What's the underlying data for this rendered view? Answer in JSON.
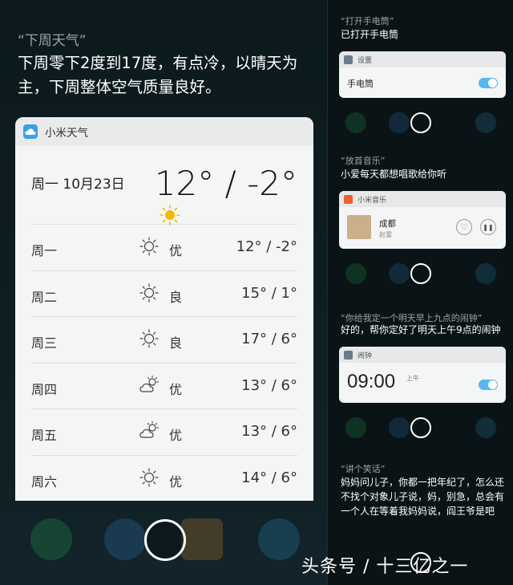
{
  "left": {
    "query": "“下周天气”",
    "answer": "下周零下2度到17度，有点冷，以晴天为主，下周整体空气质量良好。",
    "card": {
      "app_name": "小米天气",
      "today_date": "周一 10月23日",
      "today_temp": "12° / -2°",
      "rows": [
        {
          "day": "周一",
          "icon": "sunny-icon",
          "aq": "优",
          "temp": "12° / -2°"
        },
        {
          "day": "周二",
          "icon": "sunny-icon",
          "aq": "良",
          "temp": "15° / 1°"
        },
        {
          "day": "周三",
          "icon": "sunny-icon",
          "aq": "良",
          "temp": "17° / 6°"
        },
        {
          "day": "周四",
          "icon": "partly-cloudy-icon",
          "aq": "优",
          "temp": "13° / 6°"
        },
        {
          "day": "周五",
          "icon": "partly-cloudy-icon",
          "aq": "优",
          "temp": "13° / 6°"
        },
        {
          "day": "周六",
          "icon": "sunny-icon",
          "aq": "优",
          "temp": "14° / 6°"
        }
      ]
    }
  },
  "right": {
    "flashlight": {
      "query": "“打开手电筒”",
      "answer": "已打开手电筒",
      "card_app": "设置",
      "item": "手电筒",
      "toggle_on": true
    },
    "music": {
      "query": "“放首音乐”",
      "answer": "小爱每天都想唱歌给你听",
      "card_app": "小米音乐",
      "song": "成都",
      "artist": "赵雷"
    },
    "alarm": {
      "query": "“你给我定一个明天早上九点的闹钟”",
      "answer": "好的，帮你定好了明天上午9点的闹钟",
      "card_app": "闹钟",
      "time": "09:00",
      "ampm": "上午",
      "toggle_on": true
    },
    "joke": {
      "query": "“讲个笑话”",
      "answer": "妈妈问儿子，你都一把年纪了，怎么还不找个对象儿子说，妈，别急，总会有一个人在等着我妈妈说，阎王爷是吧"
    }
  },
  "watermark": "头条号 / 十三亿之一",
  "colors": {
    "accent": "#57b6f0",
    "sun": "#f5b800",
    "card": "#f4f5f5",
    "background": "#0d1a1d"
  }
}
